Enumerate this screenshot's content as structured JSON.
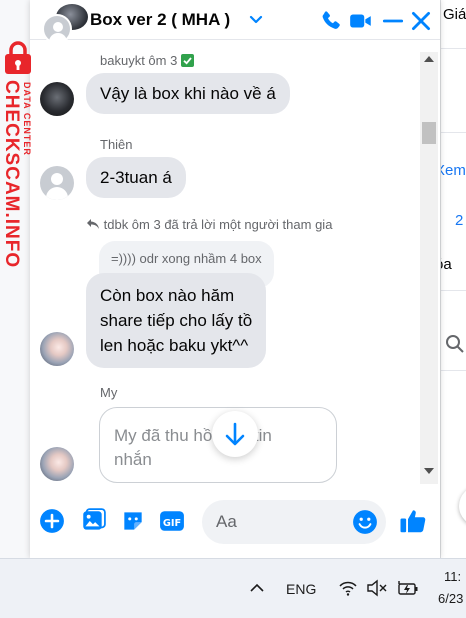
{
  "background_page": {
    "partial_texts": [
      "Giá",
      "Xem",
      "2",
      "óa",
      "Q"
    ]
  },
  "watermark": {
    "brand": "CHECKSCAM.INFO",
    "tagline": "DATA CENTER"
  },
  "chat": {
    "title": "Box ver 2 ( MHA )",
    "messages": {
      "m1_sender": "bakuykt ôm 3",
      "m1_text": "Vậy là box khi nào về á",
      "m2_sender": "Thiên",
      "m2_text": "2-3tuan á",
      "reply_note": "tdbk ôm 3 đã trả lời một người tham gia",
      "quoted_text": "=)))) odr xong nhầm 4 box",
      "m3_line1": "Còn box nào hăm",
      "m3_line2": "share tiếp cho lấy tồ",
      "m3_line3": "len hoặc baku ykt^^",
      "m4_sender": "My",
      "m4_preview": "My đã thu hồi một tin nhắn"
    },
    "composer": {
      "placeholder": "Aa"
    }
  },
  "taskbar": {
    "language": "ENG",
    "time": "11:",
    "date": "6/23"
  },
  "colors": {
    "accent": "#0084ff",
    "bubble": "#e4e6eb",
    "watermark": "#e8262b",
    "verified": "#31a24c"
  }
}
